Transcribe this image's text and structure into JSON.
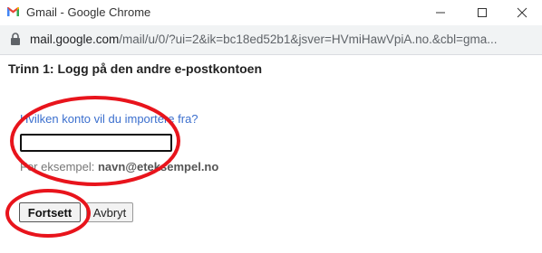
{
  "window": {
    "title": "Gmail - Google Chrome",
    "icon": "gmail-logo",
    "controls": [
      "minimize-icon",
      "maximize-icon",
      "close-icon"
    ]
  },
  "address_bar": {
    "host": "mail.google.com",
    "path": "/mail/u/0/?ui=2&ik=bc18ed52b1&jsver=HVmiHawVpiA.no.&cbl=gma...",
    "icon": "lock-icon"
  },
  "page": {
    "heading": "Trinn 1: Logg på den andre e-postkontoen",
    "question": "Hvilken konto vil du importere fra?",
    "input_value": "",
    "example_prefix": "For eksempel: ",
    "example_value": "navn@eteksempel.no",
    "continue_label": "Fortsett",
    "cancel_label": "Avbryt"
  },
  "colors": {
    "link_blue": "#3b6fce",
    "annotation_red": "#e8141c"
  }
}
